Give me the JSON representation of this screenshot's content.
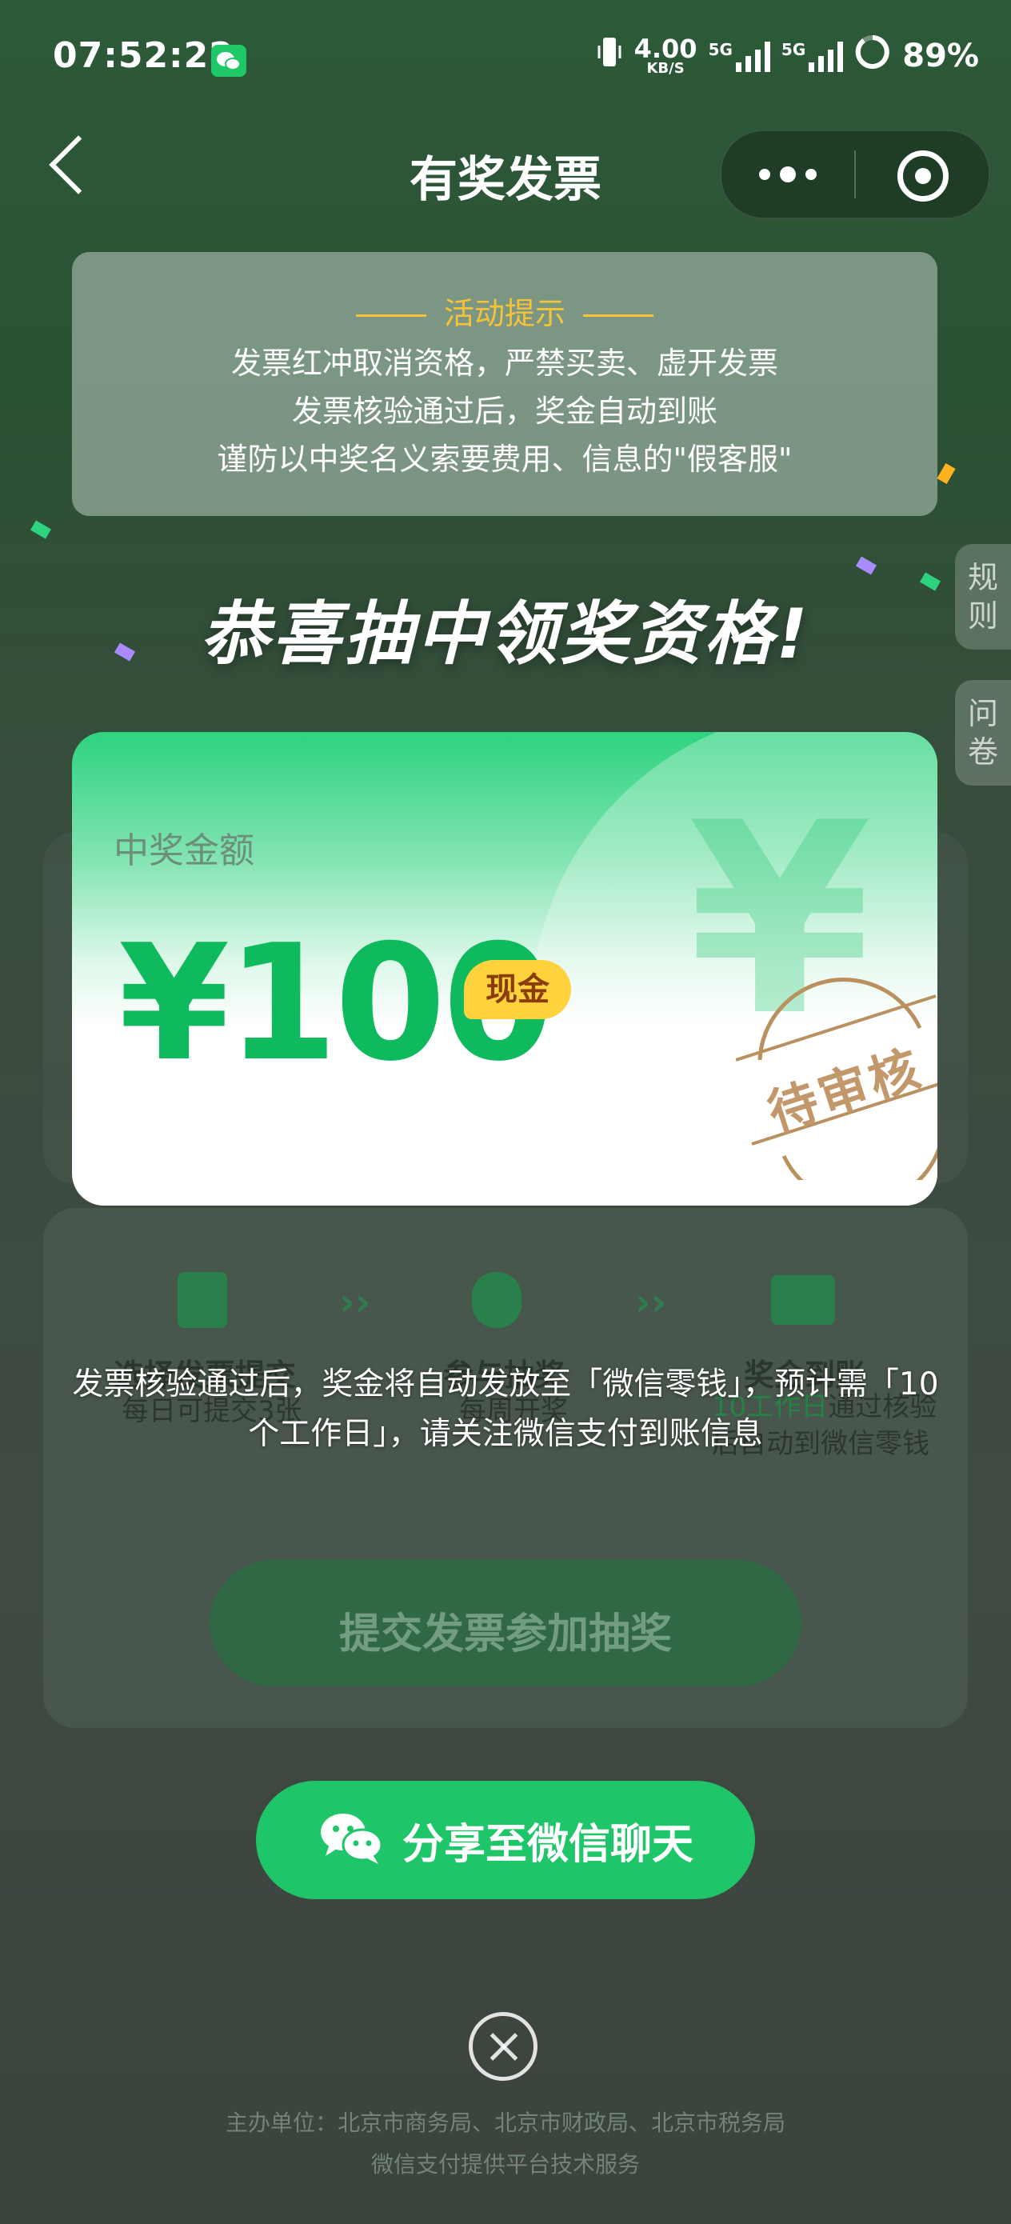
{
  "status_bar": {
    "time": "07:52:22",
    "speed_value": "4.00",
    "speed_unit": "KB/S",
    "network1": "5G",
    "network2": "5G",
    "battery": "89%"
  },
  "nav": {
    "title": "有奖发票"
  },
  "tip": {
    "title": "活动提示",
    "lines": [
      "发票红冲取消资格，严禁买卖、虚开发票",
      "发票核验通过后，奖金自动到账",
      "谨防以中奖名义索要费用、信息的\"假客服\""
    ]
  },
  "side_tabs": {
    "rules": "规则",
    "survey": "问卷"
  },
  "congrats": "恭喜抽中领奖资格!",
  "prize": {
    "label": "中奖金额",
    "amount": "¥100",
    "badge": "现金",
    "stamp_text": "待审核",
    "watermark": "¥"
  },
  "background": {
    "steps": [
      {
        "title": "选择发票提交",
        "desc": "每日可提交3张"
      },
      {
        "title": "参与抽奖",
        "desc": "每周开奖"
      },
      {
        "title": "奖金到账",
        "desc_highlight": "10工作日",
        "desc": "通过核验后自动到微信零钱"
      }
    ],
    "submit_button": "提交发票参加抽奖"
  },
  "notice": "发票核验通过后，奖金将自动发放至「微信零钱」，预计需「10个工作日」，请关注微信支付到账信息",
  "share_button": "分享至微信聊天",
  "footer": {
    "line1": "主办单位：北京市商务局、北京市财政局、北京市税务局",
    "line2": "微信支付提供平台技术服务"
  },
  "colors": {
    "accent_green": "#1fc569",
    "amount_green": "#0fb95e",
    "tip_yellow": "#f5c23a",
    "badge_yellow": "#ffd23e",
    "stamp_brown": "#b9905e"
  }
}
